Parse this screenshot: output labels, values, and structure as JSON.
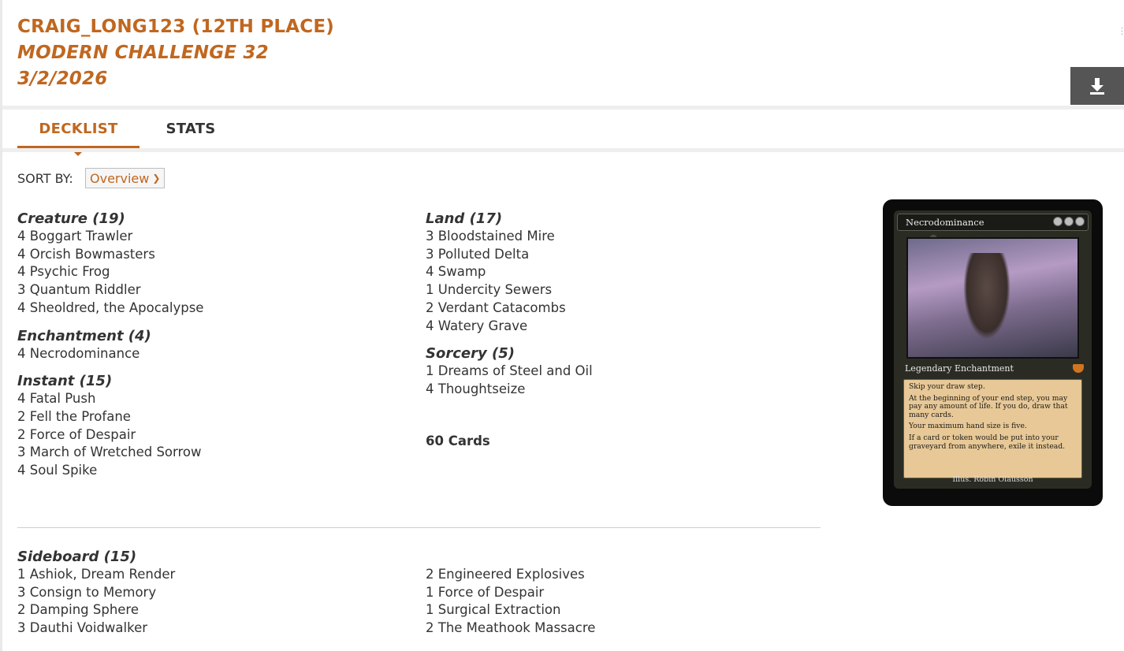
{
  "header": {
    "player": "CRAIG_LONG123 (12TH PLACE)",
    "event": "MODERN CHALLENGE 32",
    "date": "3/2/2026"
  },
  "icons": {
    "download": "download-icon",
    "corner": "minimize-icon"
  },
  "tabs": [
    {
      "label": "DECKLIST"
    },
    {
      "label": "STATS"
    }
  ],
  "sort": {
    "label": "SORT BY:",
    "selected": "Overview"
  },
  "colors": {
    "accent": "#c0671f",
    "text": "#333333",
    "button": "#555555"
  },
  "maindeck": {
    "left": [
      {
        "title": "Creature (19)",
        "cards": [
          "4 Boggart Trawler",
          "4 Orcish Bowmasters",
          "4 Psychic Frog",
          "3 Quantum Riddler",
          "4 Sheoldred, the Apocalypse"
        ]
      },
      {
        "title": "Enchantment (4)",
        "cards": [
          "4 Necrodominance"
        ]
      },
      {
        "title": "Instant (15)",
        "cards": [
          "4 Fatal Push",
          "2 Fell the Profane",
          "2 Force of Despair",
          "3 March of Wretched Sorrow",
          "4 Soul Spike"
        ]
      }
    ],
    "right": [
      {
        "title": "Land (17)",
        "cards": [
          "3 Bloodstained Mire",
          "3 Polluted Delta",
          "4 Swamp",
          "1 Undercity Sewers",
          "2 Verdant Catacombs",
          "4 Watery Grave"
        ]
      },
      {
        "title": "Sorcery (5)",
        "cards": [
          "1 Dreams of Steel and Oil",
          "4 Thoughtseize"
        ]
      }
    ],
    "total": "60 Cards"
  },
  "sideboard": {
    "title": "Sideboard (15)",
    "left": [
      "1 Ashiok, Dream Render",
      "3 Consign to Memory",
      "2 Damping Sphere",
      "3 Dauthi Voidwalker"
    ],
    "right": [
      "2 Engineered Explosives",
      "1 Force of Despair",
      "1 Surgical Extraction",
      "2 The Meathook Massacre"
    ]
  },
  "card_preview": {
    "name": "Necrodominance",
    "type": "Legendary Enchantment",
    "rules": [
      "Skip your draw step.",
      "At the beginning of your end step, you may pay any amount of life. If you do, draw that many cards.",
      "Your maximum hand size is five.",
      "If a card or token would be put into your graveyard from anywhere, exile it instead."
    ],
    "illustrator": "Illus. Robin Olausson"
  }
}
